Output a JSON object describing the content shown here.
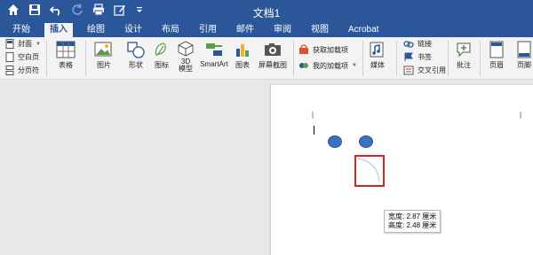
{
  "window": {
    "title": "文档1"
  },
  "quick_access": {
    "icons": [
      "home-icon",
      "save-icon",
      "undo-icon",
      "redo-icon",
      "print-icon",
      "edit-icon",
      "customize-icon"
    ]
  },
  "tabs": [
    "开始",
    "插入",
    "绘图",
    "设计",
    "布局",
    "引用",
    "邮件",
    "审阅",
    "视图",
    "Acrobat"
  ],
  "active_tab": "插入",
  "ribbon": {
    "pages": {
      "cover": "封面",
      "blank": "空白页",
      "break": "分页符"
    },
    "table": "表格",
    "picture": "图片",
    "shapes": "形状",
    "icons": "图标",
    "model3d": "3D\n模型",
    "smartart": "SmartArt",
    "chart": "图表",
    "screenshot": "屏幕截图",
    "get_addins": "获取加载项",
    "my_addins": "我的加载项",
    "media": "媒体",
    "link": "链接",
    "bookmark": "书签",
    "crossref": "交叉引用",
    "comment": "批注",
    "header": "页眉",
    "footer": "页脚"
  },
  "tooltip": {
    "width": "宽度: 2.87 厘米",
    "height": "高度: 2.48 厘米"
  },
  "colors": {
    "accent": "#2b579a",
    "selection": "#d9212a",
    "shape_fill": "#3f6fc0"
  }
}
